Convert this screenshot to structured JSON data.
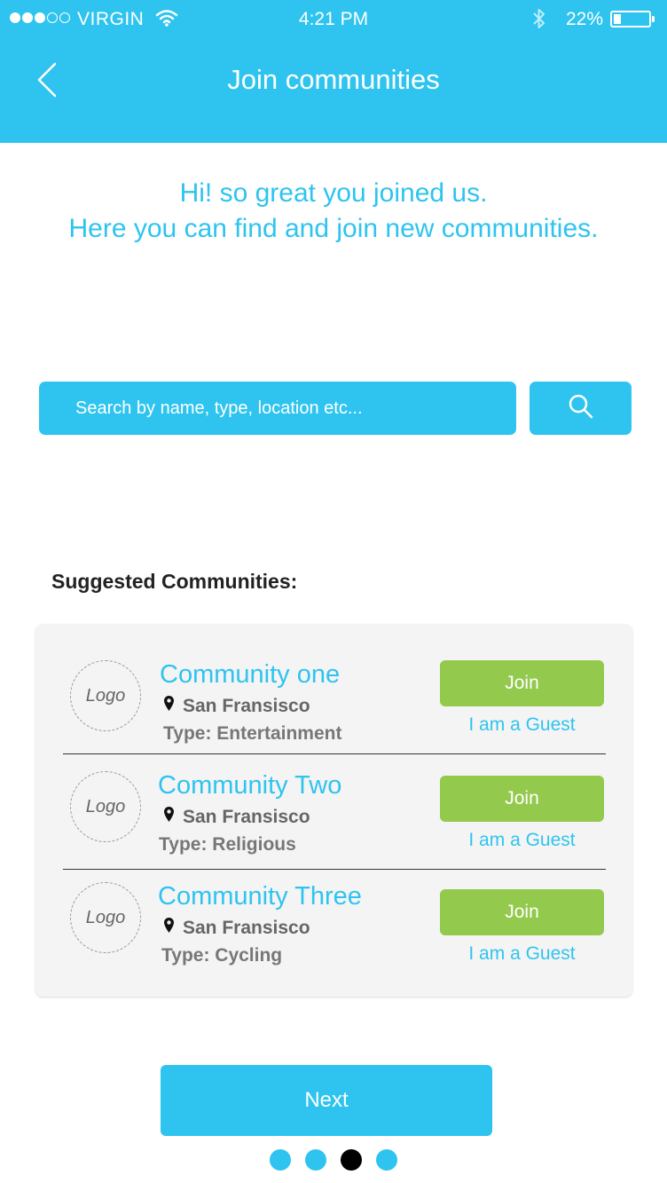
{
  "status_bar": {
    "carrier": "VIRGIN",
    "time": "4:21 PM",
    "battery_pct": "22%",
    "battery_level": 0.22,
    "signal_bars": 3,
    "signal_total": 5
  },
  "header": {
    "title": "Join communities"
  },
  "intro": {
    "line1": "Hi! so great you joined us.",
    "line2": "Here you can find and join new communities."
  },
  "search": {
    "placeholder": "Search by name, type, location etc..."
  },
  "suggested": {
    "title": "Suggested Communities:",
    "communities": [
      {
        "logo": "Logo",
        "name": "Community one",
        "location": "San Fransisco",
        "type": "Type: Entertainment",
        "join_label": "Join",
        "guest_label": "I am a Guest"
      },
      {
        "logo": "Logo",
        "name": "Community Two",
        "location": "San Fransisco",
        "type": "Type: Religious",
        "join_label": "Join",
        "guest_label": "I am a Guest"
      },
      {
        "logo": "Logo",
        "name": "Community Three",
        "location": "San Fransisco",
        "type": "Type: Cycling",
        "join_label": "Join",
        "guest_label": "I am a Guest"
      }
    ]
  },
  "footer": {
    "next_label": "Next",
    "page_count": 4,
    "current_page": 3
  },
  "colors": {
    "primary": "#2ec4ef",
    "join": "#93c94c",
    "active_dot": "#000000"
  },
  "icons": [
    "wifi-icon",
    "bluetooth-icon",
    "battery-icon",
    "back-icon",
    "search-icon",
    "location-pin-icon"
  ]
}
